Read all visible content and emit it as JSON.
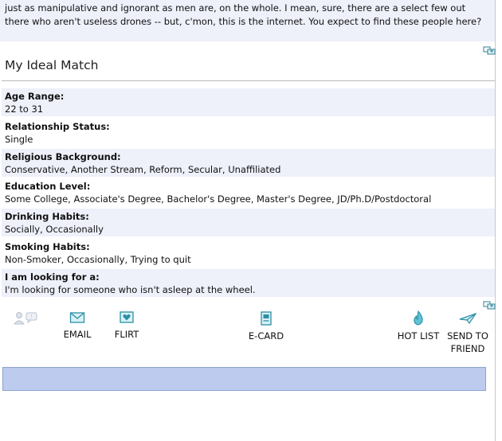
{
  "intro": {
    "text": "just as manipulative and ignorant as men are, on the whole. I mean, sure, there are a select few out there who aren't useless drones -- but, c'mon, this is the internet. You expect to find these people here?"
  },
  "section": {
    "title": "My Ideal Match"
  },
  "fields": [
    {
      "label": "Age Range:",
      "value": "22 to 31"
    },
    {
      "label": "Relationship Status:",
      "value": "Single"
    },
    {
      "label": "Religious Background:",
      "value": "Conservative, Another Stream, Reform, Secular, Unaffiliated"
    },
    {
      "label": "Education Level:",
      "value": "Some College, Associate's Degree, Bachelor's Degree, Master's Degree, JD/Ph.D/Postdoctoral"
    },
    {
      "label": "Drinking Habits:",
      "value": "Socially, Occasionally"
    },
    {
      "label": "Smoking Habits:",
      "value": "Non-Smoker, Occasionally, Trying to quit"
    },
    {
      "label": "I am looking for a:",
      "value": "I'm looking for someone who isn't asleep at the wheel."
    }
  ],
  "actions": {
    "email": "EMAIL",
    "flirt": "FLIRT",
    "ecard": "E-CARD",
    "hotlist": "HOT LIST",
    "send_line1": "SEND TO",
    "send_line2": "FRIEND"
  },
  "icons": {
    "corner": "print-icon",
    "online": "im-offline-icon",
    "email": "envelope-icon",
    "flirt": "heart-card-icon",
    "ecard": "ecard-icon",
    "hotlist": "flame-icon",
    "send": "paper-plane-icon"
  },
  "colors": {
    "band": "#eef0fa",
    "accent": "#2f9fb3",
    "bar": "#bccbee"
  }
}
